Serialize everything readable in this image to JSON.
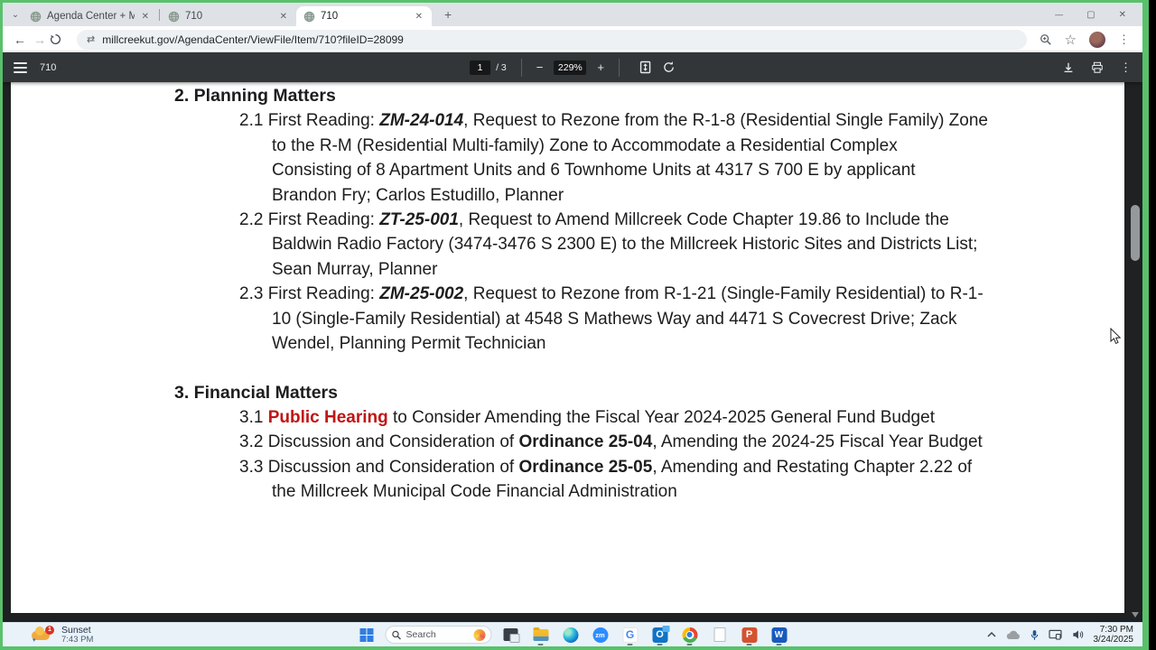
{
  "browser": {
    "tabs": [
      {
        "title": "Agenda Center + Millcreek, UT",
        "active": false
      },
      {
        "title": "710",
        "active": false
      },
      {
        "title": "710",
        "active": true
      }
    ],
    "new_tab_label": "+",
    "close_tab_label": "✕",
    "window_controls": {
      "minimize": "—",
      "maximize": "▢",
      "close": "✕"
    },
    "nav": {
      "back_label": "←",
      "forward_label": "→",
      "url": "millcreekut.gov/AgendaCenter/ViewFile/Item/710?fileID=28099",
      "star_label": "☆",
      "menu_label": "⋮"
    }
  },
  "pdf_viewer": {
    "title": "710",
    "page_current": "1",
    "page_total": "/ 3",
    "zoom_out_label": "−",
    "zoom_level": "229%",
    "zoom_in_label": "+",
    "menu_label": "⋮"
  },
  "document": {
    "sections": [
      {
        "heading": "2. Planning Matters",
        "lines": [
          {
            "indent": 0,
            "segments": [
              {
                "text": "2.1 First Reading: "
              },
              {
                "text": "ZM-24-014",
                "style": "bi"
              },
              {
                "text": ", Request to Rezone from the R-1-8 (Residential Single Family) Zone"
              }
            ]
          },
          {
            "indent": 1,
            "segments": [
              {
                "text": "to the R-M (Residential Multi-family) Zone to Accommodate a Residential Complex"
              }
            ]
          },
          {
            "indent": 1,
            "segments": [
              {
                "text": "Consisting of 8 Apartment Units and 6 Townhome Units at 4317 S 700 E by applicant"
              }
            ]
          },
          {
            "indent": 1,
            "segments": [
              {
                "text": "Brandon Fry; Carlos Estudillo, Planner"
              }
            ]
          },
          {
            "indent": 0,
            "segments": [
              {
                "text": "2.2 First Reading: "
              },
              {
                "text": "ZT-25-001",
                "style": "bi"
              },
              {
                "text": ", Request to Amend Millcreek Code Chapter 19.86 to Include the"
              }
            ]
          },
          {
            "indent": 1,
            "segments": [
              {
                "text": "Baldwin Radio Factory (3474-3476 S 2300 E) to the Millcreek Historic Sites and Districts List;"
              }
            ]
          },
          {
            "indent": 1,
            "segments": [
              {
                "text": "Sean Murray, Planner"
              }
            ]
          },
          {
            "indent": 0,
            "segments": [
              {
                "text": "2.3 First Reading: "
              },
              {
                "text": "ZM-25-002",
                "style": "bi"
              },
              {
                "text": ", Request to Rezone from R-1-21 (Single-Family Residential) to R-1-"
              }
            ]
          },
          {
            "indent": 1,
            "segments": [
              {
                "text": "10 (Single-Family Residential) at 4548 S Mathews Way and 4471 S Covecrest Drive; Zack"
              }
            ]
          },
          {
            "indent": 1,
            "segments": [
              {
                "text": "Wendel, Planning Permit Technician"
              }
            ]
          }
        ]
      },
      {
        "heading": "3. Financial Matters",
        "lines": [
          {
            "indent": 0,
            "segments": [
              {
                "text": "3.1 "
              },
              {
                "text": "Public Hearing",
                "style": "rb"
              },
              {
                "text": " to Consider Amending the Fiscal Year 2024-2025 General Fund Budget"
              }
            ]
          },
          {
            "indent": 0,
            "segments": [
              {
                "text": "3.2 Discussion and Consideration of "
              },
              {
                "text": "Ordinance 25-04",
                "style": "b"
              },
              {
                "text": ", Amending the 2024-25 Fiscal Year Budget"
              }
            ]
          },
          {
            "indent": 0,
            "segments": [
              {
                "text": "3.3 Discussion and Consideration of "
              },
              {
                "text": "Ordinance 25-05",
                "style": "b"
              },
              {
                "text": ", Amending and Restating Chapter 2.22 of"
              }
            ]
          },
          {
            "indent": 1,
            "segments": [
              {
                "text": "the Millcreek Municipal Code Financial Administration"
              }
            ]
          }
        ]
      }
    ]
  },
  "taskbar": {
    "weather": {
      "title": "Sunset",
      "time": "7:43 PM",
      "badge": "1"
    },
    "search": {
      "placeholder": "Search"
    },
    "glyphs": {
      "zoom_app": "zm",
      "google": "G",
      "outlook": "O",
      "powerpoint": "P",
      "word": "W"
    },
    "tray": {
      "time": "7:30 PM",
      "date": "3/24/2025"
    }
  },
  "colors": {
    "frame_green": "#58c16b",
    "hearing_red": "#c01515"
  }
}
